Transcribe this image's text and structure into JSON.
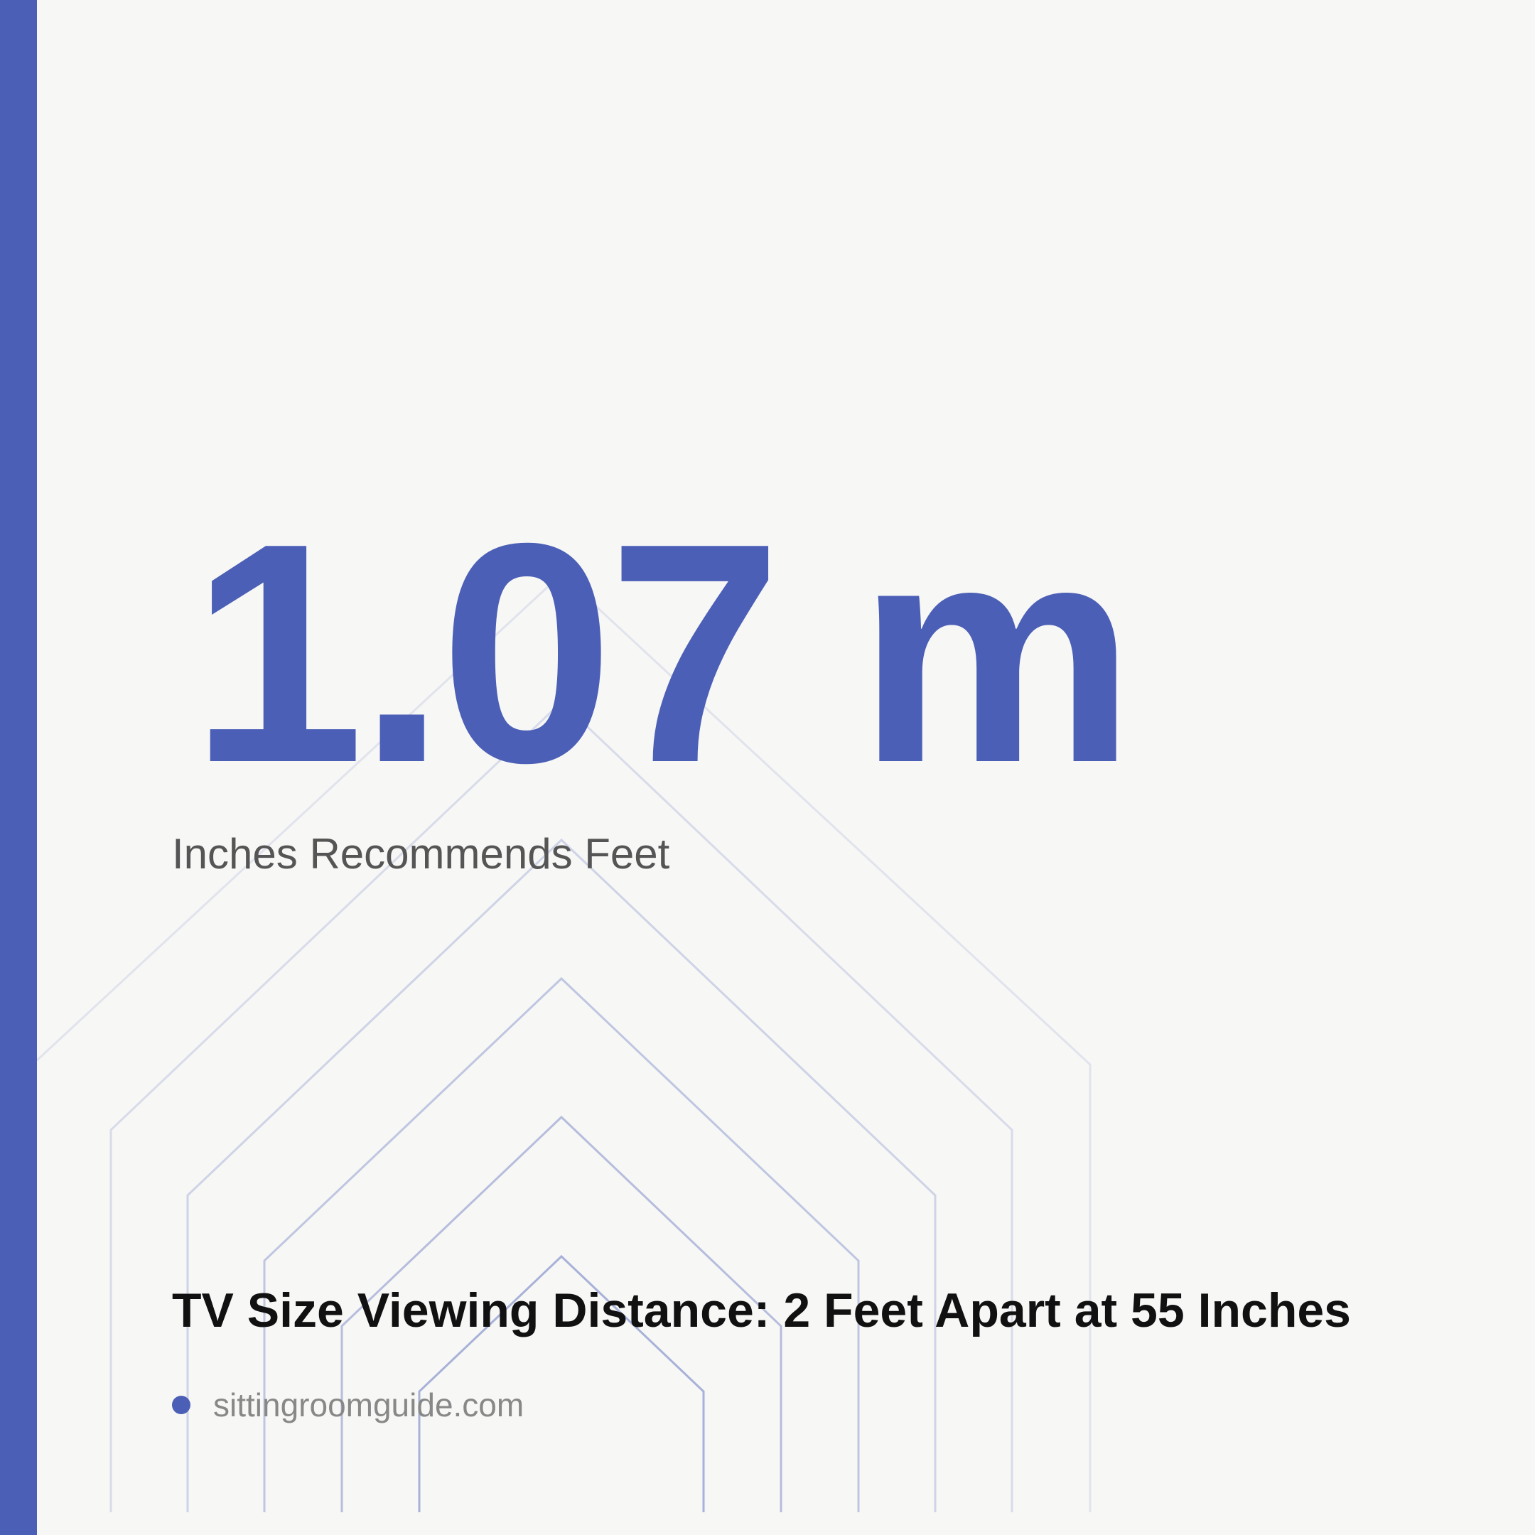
{
  "headline_value": "1.07 m",
  "subtitle": "Inches Recommends Feet",
  "title": "TV Size Viewing Distance: 2 Feet Apart at 55 Inches",
  "source": "sittingroomguide.com",
  "colors": {
    "accent": "#4b5fb6",
    "background": "#f7f7f5",
    "title_text": "#111111",
    "subtitle_text": "#555555",
    "source_text": "#888888"
  }
}
